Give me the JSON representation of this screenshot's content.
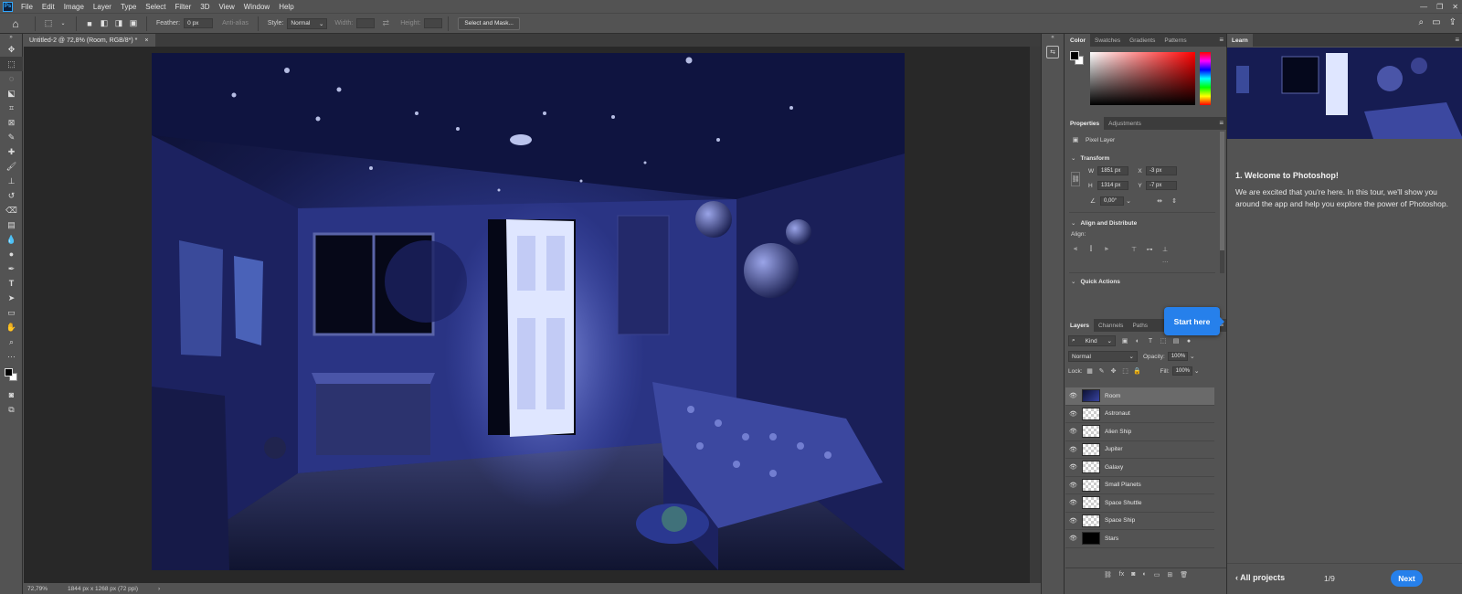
{
  "app": {
    "logo": "Ps"
  },
  "menu": [
    "File",
    "Edit",
    "Image",
    "Layer",
    "Type",
    "Select",
    "Filter",
    "3D",
    "View",
    "Window",
    "Help"
  ],
  "options": {
    "feather_label": "Feather:",
    "feather_value": "0 px",
    "antialias_label": "Anti-alias",
    "style_label": "Style:",
    "style_value": "Normal",
    "width_label": "Width:",
    "height_label": "Height:",
    "select_mask_button": "Select and Mask..."
  },
  "document": {
    "tab_title": "Untitled-2 @ 72,8% (Room, RGB/8*) *",
    "close": "×"
  },
  "status": {
    "zoom": "72,79%",
    "info": "1844 px x 1268 px (72 ppi)",
    "arrow": "›"
  },
  "color_panel": {
    "tabs": [
      "Color",
      "Swatches",
      "Gradients",
      "Patterns"
    ]
  },
  "properties_panel": {
    "tabs": [
      "Properties",
      "Adjustments"
    ],
    "layer_type": "Pixel Layer",
    "transform_header": "Transform",
    "w_label": "W",
    "w_value": "1851 px",
    "h_label": "H",
    "h_value": "1314 px",
    "x_label": "X",
    "x_value": "-3 px",
    "y_label": "Y",
    "y_value": "-7 px",
    "angle_value": "0,00°",
    "align_header": "Align and Distribute",
    "align_label": "Align:",
    "more": "···",
    "quick_actions_header": "Quick Actions"
  },
  "start_here": "Start here",
  "layers_panel": {
    "tabs": [
      "Layers",
      "Channels",
      "Paths"
    ],
    "kind_label": "Kind",
    "blend_mode": "Normal",
    "opacity_label": "Opacity:",
    "opacity_value": "100%",
    "lock_label": "Lock:",
    "fill_label": "Fill:",
    "fill_value": "100%",
    "layers": [
      {
        "name": "Room",
        "selected": true
      },
      {
        "name": "Astronaut"
      },
      {
        "name": "Alien Ship"
      },
      {
        "name": "Jupiter"
      },
      {
        "name": "Galaxy"
      },
      {
        "name": "Small Planets"
      },
      {
        "name": "Space Shuttle"
      },
      {
        "name": "Space Ship"
      },
      {
        "name": "Stars"
      }
    ]
  },
  "learn_panel": {
    "tab": "Learn",
    "title": "1.  Welcome to Photoshop!",
    "text": "We are excited that you're here. In this tour, we'll show you around the app and help you explore the power of Photoshop.",
    "all_projects": "‹  All projects",
    "page": "1/9",
    "next": "Next"
  },
  "colors": {
    "accent": "#2680eb",
    "panel_bg": "#535353",
    "canvas_bg": "#282828"
  }
}
